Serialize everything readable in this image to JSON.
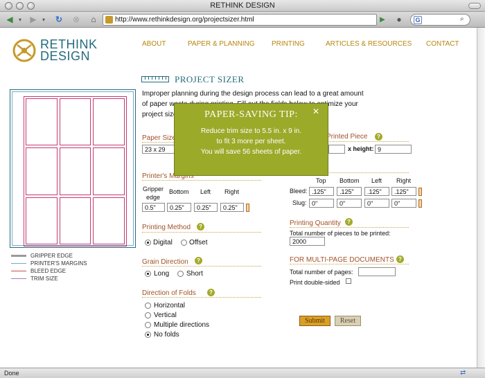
{
  "window": {
    "title": "RETHINK DESIGN"
  },
  "toolbar": {
    "url": "http://www.rethinkdesign.org/projectsizer.html",
    "search_placeholder": "",
    "back_icon": "back-arrow-icon",
    "forward_icon": "forward-arrow-icon",
    "reload_icon": "reload-icon",
    "stop_icon": "stop-icon",
    "home_icon": "home-icon"
  },
  "status": {
    "text": "Done"
  },
  "logo": {
    "line1": "RETHINK",
    "line2": "DESIGN"
  },
  "nav": [
    "ABOUT",
    "PAPER & PLANNING",
    "PRINTING",
    "ARTICLES & RESOURCES",
    "CONTACT"
  ],
  "heading": {
    "title": "PROJECT SIZER"
  },
  "intro": "Improper planning during the design process can lead to a great amount of paper waste during printing. Fill out the fields below to optimize your project size and red",
  "legend": [
    {
      "label": "GRIPPER EDGE",
      "color": "#9a9a9a"
    },
    {
      "label": "PRINTER'S MARGINS",
      "color": "#7aa7d0"
    },
    {
      "label": "BLEED EDGE",
      "color": "#d04a4a"
    },
    {
      "label": "TRIM SIZE",
      "color": "#a87ac0"
    }
  ],
  "paper_size": {
    "label": "Paper Size",
    "value": "23 x 29"
  },
  "printed_piece": {
    "label": "Printed Piece",
    "height_label": "x height:",
    "width": "",
    "height": "9"
  },
  "printer_margins": {
    "label": "Printer's Margins",
    "headers": [
      "Gripper edge",
      "Bottom",
      "Left",
      "Right"
    ],
    "values": [
      "0.5\"",
      "0.25\"",
      "0.25\"",
      "0.25\""
    ]
  },
  "bleed_slug": {
    "headers": [
      "Top",
      "Bottom",
      "Left",
      "Right"
    ],
    "bleed_label": "Bleed:",
    "bleed": [
      ".125\"",
      ".125\"",
      ".125\"",
      ".125\""
    ],
    "slug_label": "Slug:",
    "slug": [
      "0\"",
      "0\"",
      "0\"",
      "0\""
    ]
  },
  "printing_method": {
    "label": "Printing Method",
    "options": [
      "Digital",
      "Offset"
    ],
    "selected": "Digital"
  },
  "printing_quantity": {
    "label": "Printing Quantity",
    "sub_label": "Total number of pieces to be printed:",
    "value": "2000"
  },
  "grain_direction": {
    "label": "Grain Direction",
    "options": [
      "Long",
      "Short"
    ],
    "selected": "Long"
  },
  "multi_page": {
    "label": "FOR MULTI-PAGE DOCUMENTS",
    "pages_label": "Total number of pages:",
    "pages_value": "",
    "double_sided_label": "Print double-sided"
  },
  "folds": {
    "label": "Direction of Folds",
    "options": [
      "Horizontal",
      "Vertical",
      "Multiple directions",
      "No folds"
    ],
    "selected": "No folds"
  },
  "buttons": {
    "submit": "Submit",
    "reset": "Reset"
  },
  "popup": {
    "title": "PAPER-SAVING TIP:",
    "line1": "Reduce trim size to 5.5 in. x 9 in.",
    "line2": "to fit 3 more per sheet.",
    "line3": "You will save 56 sheets of paper.",
    "close": "✕"
  },
  "colors": {
    "accent_teal": "#236b7c",
    "section_label": "#a0512a",
    "nav": "#b8860b",
    "popup_bg": "#9caa2a",
    "trim": "#c33a6e"
  }
}
